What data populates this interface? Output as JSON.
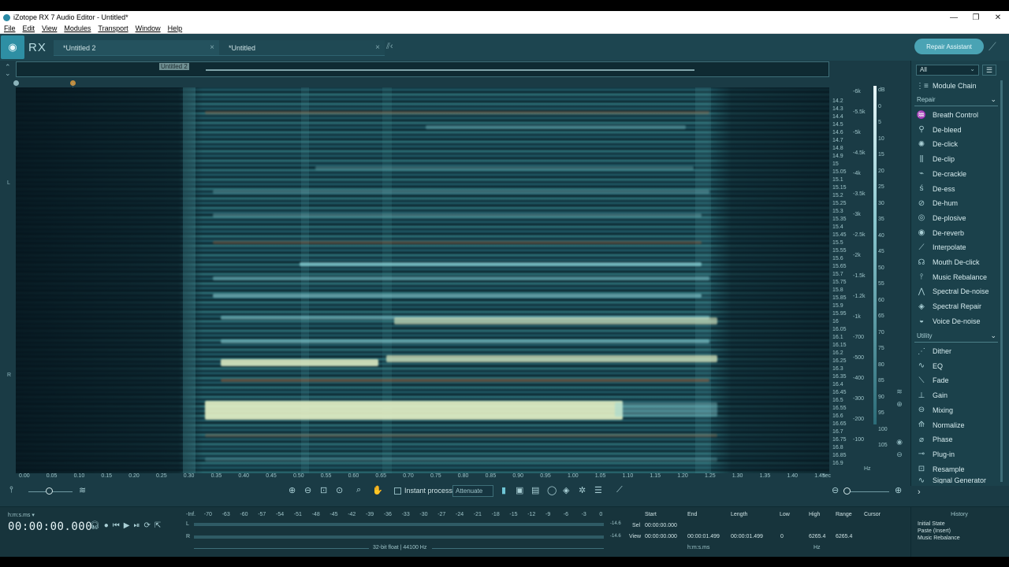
{
  "window": {
    "title": "iZotope RX 7 Audio Editor - Untitled*",
    "minimize": "—",
    "maximize": "❐",
    "close": "✕"
  },
  "menu": [
    "File",
    "Edit",
    "View",
    "Modules",
    "Transport",
    "Window",
    "Help"
  ],
  "header": {
    "logo_text": "RX",
    "tabs": [
      {
        "label": "*Untitled 2"
      },
      {
        "label": "*Untitled"
      }
    ],
    "repair_assistant": "Repair Assistant"
  },
  "overview": {
    "label": "Untitled 2"
  },
  "channels": {
    "left": "L",
    "right": "R"
  },
  "freq_ticks": [
    "14.2",
    "14.3",
    "14.4",
    "14.5",
    "14.6",
    "14.7",
    "14.8",
    "14.9",
    "15",
    "15.05",
    "15.1",
    "15.15",
    "15.2",
    "15.25",
    "15.3",
    "15.35",
    "15.4",
    "15.45",
    "15.5",
    "15.55",
    "15.6",
    "15.65",
    "15.7",
    "15.75",
    "15.8",
    "15.85",
    "15.9",
    "15.95",
    "16",
    "16.05",
    "16.1",
    "16.15",
    "16.2",
    "16.25",
    "16.3",
    "16.35",
    "16.4",
    "16.45",
    "16.5",
    "16.55",
    "16.6",
    "16.65",
    "16.7",
    "16.75",
    "16.8",
    "16.85",
    "16.9"
  ],
  "freq_right_ticks": [
    "-6k",
    "-5.5k",
    "-5k",
    "-4.5k",
    "-4k",
    "-3.5k",
    "-3k",
    "-2.5k",
    "-2k",
    "-1.5k",
    "-1.2k",
    "-1k",
    "-700",
    "-500",
    "-400",
    "-300",
    "-200",
    "-100"
  ],
  "db_ticks": [
    "dB",
    "0",
    "5",
    "10",
    "15",
    "20",
    "25",
    "30",
    "35",
    "40",
    "45",
    "50",
    "55",
    "60",
    "65",
    "70",
    "75",
    "80",
    "85",
    "90",
    "95",
    "100",
    "105"
  ],
  "hz_label": "Hz",
  "time_ticks": [
    "0.00",
    "0.05",
    "0.10",
    "0.15",
    "0.20",
    "0.25",
    "0.30",
    "0.35",
    "0.40",
    "0.45",
    "0.50",
    "0.55",
    "0.60",
    "0.65",
    "0.70",
    "0.75",
    "0.80",
    "0.85",
    "0.90",
    "0.95",
    "1.00",
    "1.05",
    "1.10",
    "1.15",
    "1.20",
    "1.25",
    "1.30",
    "1.35",
    "1.40",
    "1.45"
  ],
  "time_unit": "sec",
  "toolbar": {
    "instant_process": "Instant process",
    "attenuate": "Attenuate"
  },
  "side": {
    "filter": "All",
    "module_chain": "Module Chain",
    "repair_title": "Repair",
    "repair": [
      {
        "label": "Breath Control",
        "icon": "breath-icon"
      },
      {
        "label": "De-bleed",
        "icon": "debleed-icon"
      },
      {
        "label": "De-click",
        "icon": "declick-icon"
      },
      {
        "label": "De-clip",
        "icon": "declip-icon"
      },
      {
        "label": "De-crackle",
        "icon": "decrackle-icon"
      },
      {
        "label": "De-ess",
        "icon": "deess-icon"
      },
      {
        "label": "De-hum",
        "icon": "dehum-icon"
      },
      {
        "label": "De-plosive",
        "icon": "deplosive-icon"
      },
      {
        "label": "De-reverb",
        "icon": "dereverb-icon"
      },
      {
        "label": "Interpolate",
        "icon": "interpolate-icon"
      },
      {
        "label": "Mouth De-click",
        "icon": "mouth-icon"
      },
      {
        "label": "Music Rebalance",
        "icon": "rebalance-icon"
      },
      {
        "label": "Spectral De-noise",
        "icon": "denoise-icon"
      },
      {
        "label": "Spectral Repair",
        "icon": "spectral-repair-icon"
      },
      {
        "label": "Voice De-noise",
        "icon": "voice-icon"
      }
    ],
    "utility_title": "Utility",
    "utility": [
      {
        "label": "Dither",
        "icon": "dither-icon"
      },
      {
        "label": "EQ",
        "icon": "eq-icon"
      },
      {
        "label": "Fade",
        "icon": "fade-icon"
      },
      {
        "label": "Gain",
        "icon": "gain-icon"
      },
      {
        "label": "Mixing",
        "icon": "mixing-icon"
      },
      {
        "label": "Normalize",
        "icon": "normalize-icon"
      },
      {
        "label": "Phase",
        "icon": "phase-icon"
      },
      {
        "label": "Plug-in",
        "icon": "plugin-icon"
      },
      {
        "label": "Resample",
        "icon": "resample-icon"
      },
      {
        "label": "Signal Generator",
        "icon": "signal-icon"
      }
    ]
  },
  "bottom": {
    "timecode_format": "h:m:s.ms ▾",
    "timecode": "00:00:00.000",
    "meter_scale": [
      "-Inf.",
      "-70",
      "-63",
      "-60",
      "-57",
      "-54",
      "-51",
      "-48",
      "-45",
      "-42",
      "-39",
      "-36",
      "-33",
      "-30",
      "-27",
      "-24",
      "-21",
      "-18",
      "-15",
      "-12",
      "-9",
      "-6",
      "-3",
      "0"
    ],
    "left": "L",
    "right": "R",
    "peak_l": "-14.6",
    "peak_r": "-14.6",
    "format": "32-bit float | 44100 Hz",
    "sel": {
      "headers": [
        "Start",
        "End",
        "Length",
        "Low",
        "High",
        "Range",
        "Cursor"
      ],
      "sel_label": "Sel",
      "view_label": "View",
      "sel_start": "00:00:00.000",
      "view_start": "00:00:00.000",
      "view_end": "00:00:01.499",
      "view_length": "00:00:01.499",
      "low": "0",
      "high": "6265.4",
      "range": "6265.4",
      "unit_time": "h:m:s.ms",
      "unit_hz": "Hz"
    }
  },
  "history": {
    "title": "History",
    "items": [
      "Initial State",
      "Paste (Insert)",
      "Music Rebalance"
    ]
  }
}
